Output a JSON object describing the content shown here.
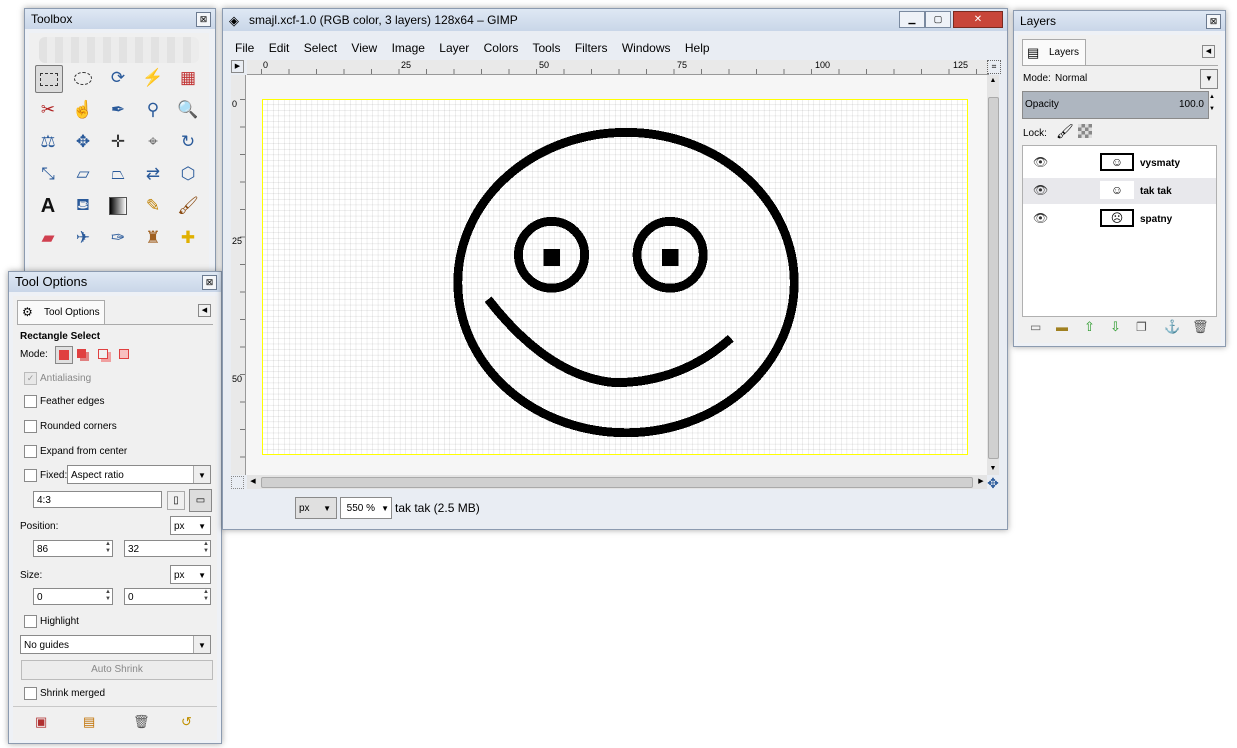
{
  "toolbox": {
    "title": "Toolbox",
    "close": "⊠"
  },
  "tool_options": {
    "title": "Tool Options",
    "tab_label": "Tool Options",
    "tool_name": "Rectangle Select",
    "mode_label": "Mode:",
    "antialiasing": "Antialiasing",
    "feather_edges": "Feather edges",
    "rounded_corners": "Rounded corners",
    "expand_from_center": "Expand from center",
    "fixed_label": "Fixed:",
    "fixed_value": "Aspect ratio",
    "ratio_value": "4:3",
    "position_label": "Position:",
    "position_unit": "px",
    "pos_x": "86",
    "pos_y": "32",
    "size_label": "Size:",
    "size_unit": "px",
    "size_w": "0",
    "size_h": "0",
    "highlight": "Highlight",
    "guides_value": "No guides",
    "auto_shrink": "Auto Shrink",
    "shrink_merged": "Shrink merged"
  },
  "image_window": {
    "title": "smajl.xcf-1.0 (RGB color, 3 layers) 128x64 – GIMP",
    "menu": [
      "File",
      "Edit",
      "Select",
      "View",
      "Image",
      "Layer",
      "Colors",
      "Tools",
      "Filters",
      "Windows",
      "Help"
    ],
    "ruler_h": [
      "0",
      "25",
      "50",
      "75",
      "100",
      "125"
    ],
    "ruler_v": [
      "0",
      "25",
      "50"
    ],
    "unit": "px",
    "zoom": "550 %",
    "status": "tak tak (2.5 MB)"
  },
  "layers": {
    "title": "Layers",
    "tab_label": "Layers",
    "mode_label": "Mode:",
    "mode_value": "Normal",
    "opacity_label": "Opacity",
    "opacity_value": "100.0",
    "lock_label": "Lock:",
    "items": [
      {
        "name": "vysmaty",
        "thumb": "☺"
      },
      {
        "name": "tak tak",
        "thumb": "☺"
      },
      {
        "name": "spatny",
        "thumb": "☹"
      }
    ]
  },
  "colors": {
    "accent": "#2a5a9a",
    "canvas_border": "#ffff00",
    "close_red": "#c0392b"
  }
}
